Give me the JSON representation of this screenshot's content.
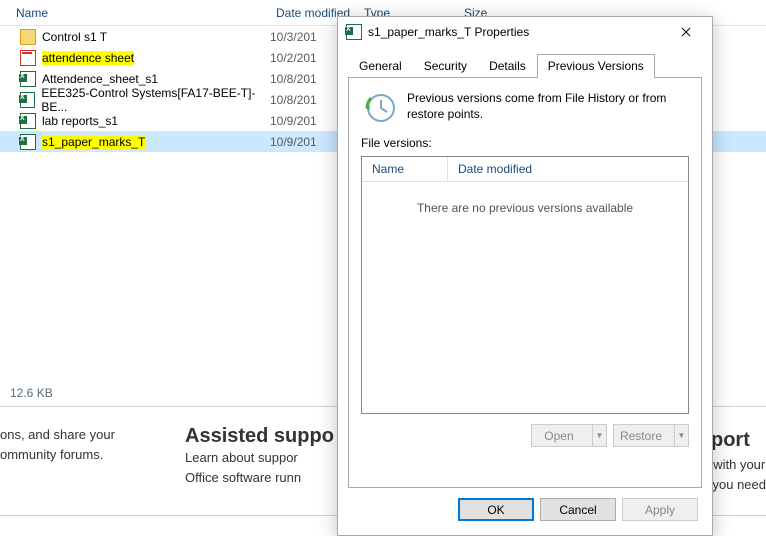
{
  "explorer": {
    "columns": {
      "name": "Name",
      "date": "Date modified",
      "type": "Type",
      "size": "Size"
    },
    "rows": [
      {
        "icon": "folder",
        "name": "Control s1 T",
        "date": "10/3/201",
        "highlight": false,
        "selected": false
      },
      {
        "icon": "pdf",
        "name": "attendence sheet",
        "date": "10/2/201",
        "highlight": true,
        "selected": false
      },
      {
        "icon": "excel",
        "name": "Attendence_sheet_s1",
        "date": "10/8/201",
        "highlight": false,
        "selected": false
      },
      {
        "icon": "excel",
        "name": "EEE325-Control Systems[FA17-BEE-T]-BE...",
        "date": "10/8/201",
        "highlight": false,
        "selected": false
      },
      {
        "icon": "excel",
        "name": "lab reports_s1",
        "date": "10/9/201",
        "highlight": false,
        "selected": false
      },
      {
        "icon": "excel",
        "name": "s1_paper_marks_T",
        "date": "10/9/201",
        "highlight": true,
        "selected": true
      }
    ],
    "status": "12.6 KB"
  },
  "bottom": {
    "left_line1": "ons, and share your",
    "left_line2": "ommunity forums.",
    "mid_title": "Assisted suppo",
    "mid_line1": "Learn about suppor",
    "mid_line2": "Office software runn",
    "right_title": "pport",
    "right_line1": "te with your",
    "right_line2": "lp you need"
  },
  "dialog": {
    "title": "s1_paper_marks_T Properties",
    "tabs": {
      "general": "General",
      "security": "Security",
      "details": "Details",
      "previous": "Previous Versions"
    },
    "info": "Previous versions come from File History or from restore points.",
    "file_versions_label": "File versions:",
    "list_columns": {
      "name": "Name",
      "date": "Date modified"
    },
    "empty": "There are no previous versions available",
    "buttons": {
      "open": "Open",
      "restore": "Restore",
      "ok": "OK",
      "cancel": "Cancel",
      "apply": "Apply"
    }
  }
}
